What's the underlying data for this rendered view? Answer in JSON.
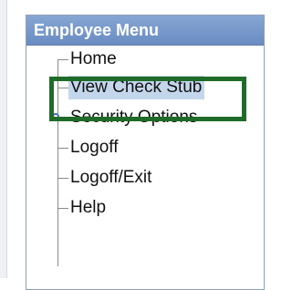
{
  "panel": {
    "title": "Employee Menu"
  },
  "menu": {
    "items": [
      {
        "label": "Home",
        "icon": "tree-line"
      },
      {
        "label": "View Check Stub",
        "icon": "tree-line",
        "selected": true
      },
      {
        "label": "Security Options",
        "icon": "expand-node-icon"
      },
      {
        "label": "Logoff",
        "icon": "tree-line"
      },
      {
        "label": "Logoff/Exit",
        "icon": "tree-line"
      },
      {
        "label": "Help",
        "icon": "tree-line"
      }
    ]
  },
  "colors": {
    "header": "#6a8cc2",
    "selection": "#c4d6ec",
    "highlight_frame": "#1f6b2a"
  }
}
